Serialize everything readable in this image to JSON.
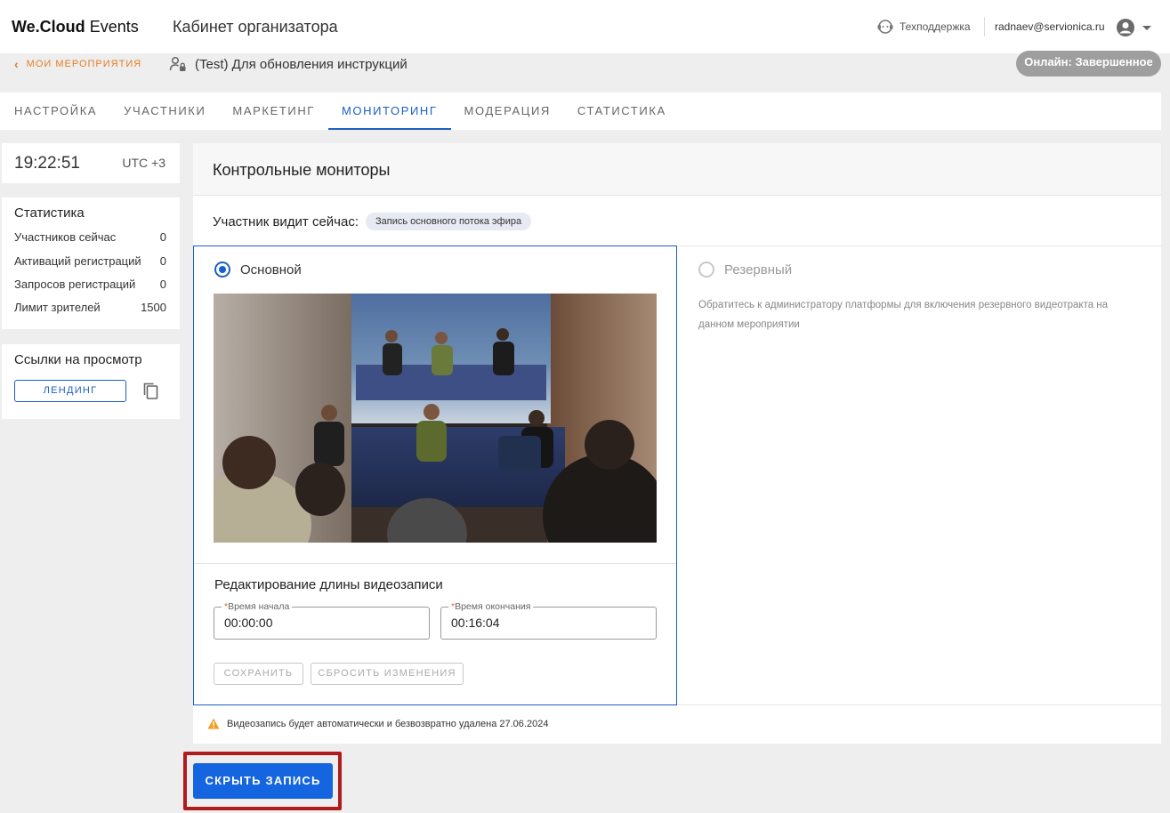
{
  "header": {
    "logo_bold": "We.Cloud",
    "logo_light": "Events",
    "cabinet_title": "Кабинет организатора",
    "support_label": "Техподдержка",
    "user_email": "radnaev@servionica.ru"
  },
  "breadcrumb": {
    "back_label": "МОИ МЕРОПРИЯТИЯ"
  },
  "event": {
    "title": "(Test) Для обновления инструкций",
    "status": "Онлайн: Завершенное"
  },
  "tabs": [
    {
      "label": "НАСТРОЙКА",
      "active": false
    },
    {
      "label": "УЧАСТНИКИ",
      "active": false
    },
    {
      "label": "МАРКЕТИНГ",
      "active": false
    },
    {
      "label": "МОНИТОРИНГ",
      "active": true
    },
    {
      "label": "МОДЕРАЦИЯ",
      "active": false
    },
    {
      "label": "СТАТИСТИКА",
      "active": false
    }
  ],
  "clock": {
    "time": "19:22:51",
    "timezone": "UTC +3"
  },
  "stats": {
    "title": "Статистика",
    "rows": [
      {
        "label": "Участников сейчас",
        "value": "0"
      },
      {
        "label": "Активаций регистраций",
        "value": "0"
      },
      {
        "label": "Запросов регистраций",
        "value": "0"
      },
      {
        "label": "Лимит зрителей",
        "value": "1500"
      }
    ]
  },
  "links": {
    "title": "Ссылки на просмотр",
    "landing_label": "ЛЕНДИНГ"
  },
  "monitors": {
    "title": "Контрольные мониторы",
    "viewer_sees_label": "Участник видит сейчас:",
    "viewer_sees_chip": "Запись основного потока эфира",
    "main_label": "Основной",
    "backup_label": "Резервный",
    "backup_note": "Обратитесь к администратору платформы для включения резервного видеотракта на данном мероприятии"
  },
  "edit": {
    "title": "Редактирование длины видеозаписи",
    "start_label": "Время начала",
    "start_value": "00:00:00",
    "end_label": "Время окончания",
    "end_value": "00:16:04",
    "save_label": "СОХРАНИТЬ",
    "reset_label": "СБРОСИТЬ ИЗМЕНЕНИЯ"
  },
  "warning": {
    "text": "Видеозапись будет автоматически и безвозвратно удалена 27.06.2024"
  },
  "hide_button_label": "СКРЫТЬ ЗАПИСЬ",
  "colors": {
    "accent": "#1565e0",
    "tab_active": "#1c5fc4",
    "breadcrumb": "#e67e22",
    "status_pill": "#9e9e9e",
    "highlight": "#b01c1c"
  }
}
